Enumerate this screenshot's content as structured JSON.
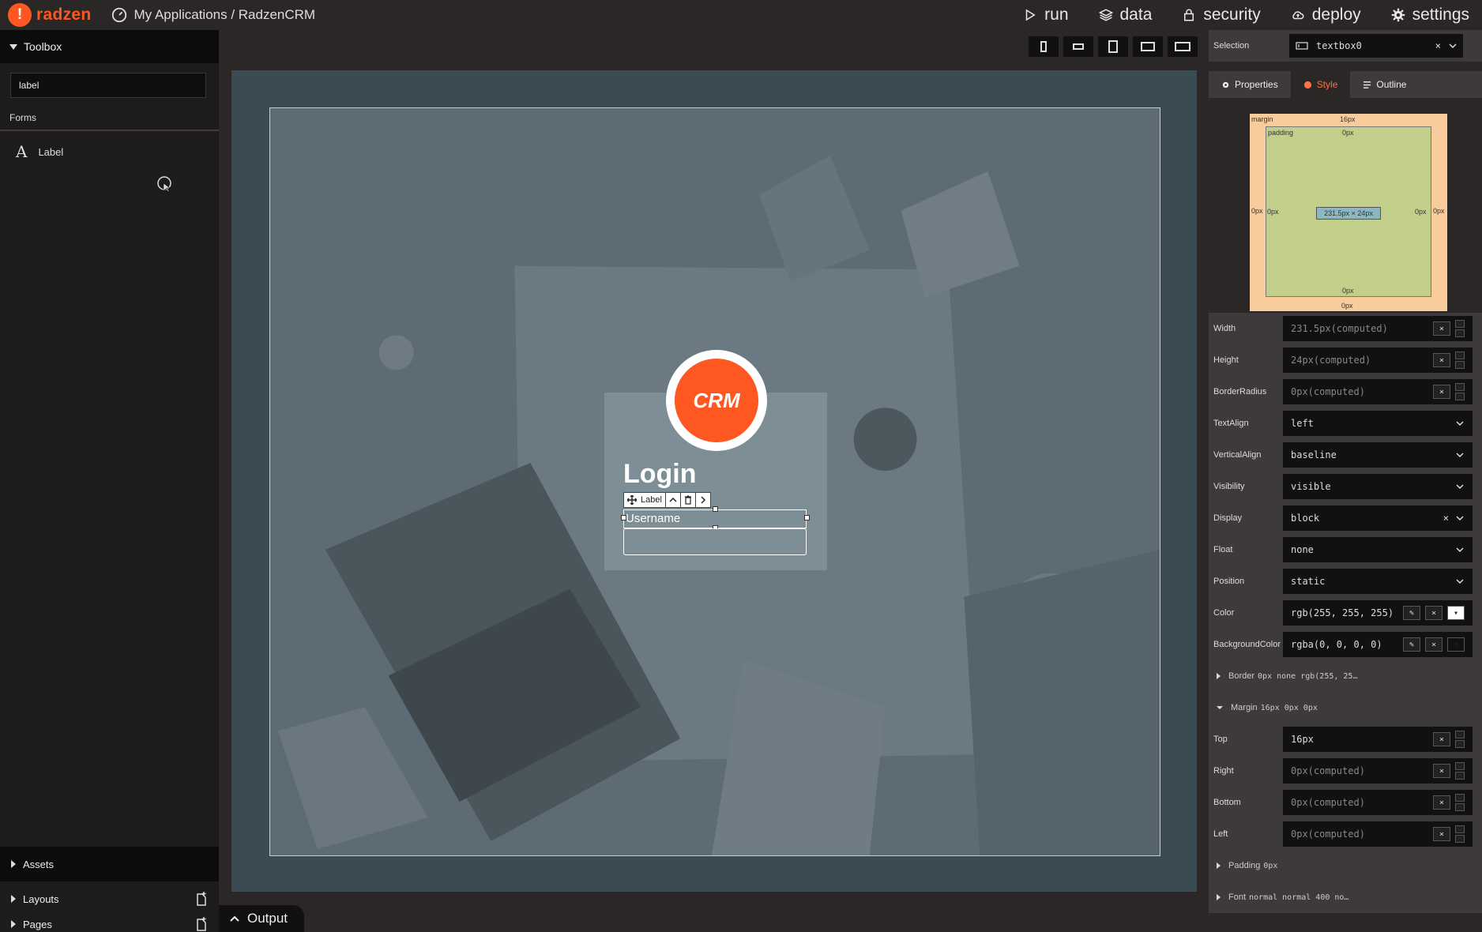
{
  "app": {
    "brand": "radzen",
    "breadcrumb": "My Applications / RadzenCRM",
    "nav": [
      {
        "label": "run",
        "icon": "play-icon"
      },
      {
        "label": "data",
        "icon": "layers-icon"
      },
      {
        "label": "security",
        "icon": "lock-icon"
      },
      {
        "label": "deploy",
        "icon": "cloud-upload-icon"
      },
      {
        "label": "settings",
        "icon": "gear-icon"
      }
    ]
  },
  "toolbox": {
    "title": "Toolbox",
    "search_value": "label",
    "section": "Forms",
    "items": [
      {
        "label": "Label",
        "icon": "letter-a-icon"
      }
    ],
    "bottom": [
      {
        "label": "Assets"
      },
      {
        "label": "Layouts"
      },
      {
        "label": "Pages"
      }
    ]
  },
  "designer": {
    "login_title": "Login",
    "logo_text": "CRM",
    "label_toolbar": "Label",
    "username_label": "Username",
    "output_tab": "Output"
  },
  "inspector": {
    "selection_label": "Selection",
    "selection_value": "textbox0",
    "tabs": [
      {
        "label": "Properties",
        "active": false
      },
      {
        "label": "Style",
        "active": true
      },
      {
        "label": "Outline",
        "active": false
      }
    ],
    "boxmodel": {
      "margin_label": "margin",
      "margin_top": "16px",
      "margin_left": "0px",
      "margin_right": "0px",
      "margin_bottom": "0px",
      "padding_label": "padding",
      "padding_top": "0px",
      "padding_left": "0px",
      "padding_right": "0px",
      "padding_bottom": "0px",
      "content": "231.5px × 24px"
    },
    "props": [
      {
        "label": "Width",
        "value": "231.5px(computed)",
        "type": "num"
      },
      {
        "label": "Height",
        "value": "24px(computed)",
        "type": "num"
      },
      {
        "label": "BorderRadius",
        "value": "0px(computed)",
        "type": "num"
      },
      {
        "label": "TextAlign",
        "value": "left",
        "type": "select"
      },
      {
        "label": "VerticalAlign",
        "value": "baseline",
        "type": "select"
      },
      {
        "label": "Visibility",
        "value": "visible",
        "type": "select"
      },
      {
        "label": "Display",
        "value": "block",
        "type": "select-x"
      },
      {
        "label": "Float",
        "value": "none",
        "type": "select"
      },
      {
        "label": "Position",
        "value": "static",
        "type": "select"
      },
      {
        "label": "Color",
        "value": "rgb(255, 255, 255)",
        "type": "color"
      },
      {
        "label": "BackgroundColor",
        "value": "rgba(0, 0, 0, 0)",
        "type": "color"
      }
    ],
    "border_section": "Border",
    "border_value": "0px none rgb(255, 25…",
    "margin_section": "Margin",
    "margin_value": "16px 0px 0px",
    "margin_props": [
      {
        "label": "Top",
        "value": "16px"
      },
      {
        "label": "Right",
        "value": "0px(computed)"
      },
      {
        "label": "Bottom",
        "value": "0px(computed)"
      },
      {
        "label": "Left",
        "value": "0px(computed)"
      }
    ],
    "padding_section": "Padding",
    "padding_value": "0px",
    "font_section": "Font",
    "font_value": "normal normal 400 no…"
  },
  "colors": {
    "brand": "#ff5722",
    "panel": "#2a2726",
    "stage": "#3b4b54",
    "card": "#7d8e97"
  }
}
